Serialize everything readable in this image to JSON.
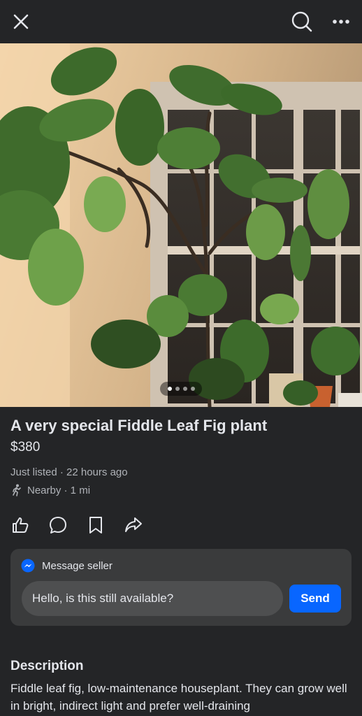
{
  "header": {
    "close_icon": "close-icon",
    "search_icon": "search-icon",
    "more_icon": "more-icon"
  },
  "gallery": {
    "photo_subject": "fiddle-leaf-fig-plant-photo",
    "image_count": 4,
    "active_index": 0
  },
  "listing": {
    "title": "A very special Fiddle Leaf Fig plant",
    "price": "$380",
    "listed": "Just listed · 22 hours ago",
    "location": "Nearby · 1 mi"
  },
  "actions": [
    "like-icon",
    "comment-icon",
    "save-icon",
    "share-icon"
  ],
  "message": {
    "header": "Message seller",
    "input_value": "Hello, is this still available?",
    "send_label": "Send"
  },
  "description": {
    "heading": "Description",
    "text": "Fiddle leaf fig, low-maintenance houseplant. They can grow well in bright, indirect light and prefer well-draining"
  },
  "colors": {
    "background": "#242527",
    "card": "#3a3b3c",
    "accent": "#0866ff",
    "text": "#e4e6eb",
    "muted": "#b0b3b8"
  }
}
